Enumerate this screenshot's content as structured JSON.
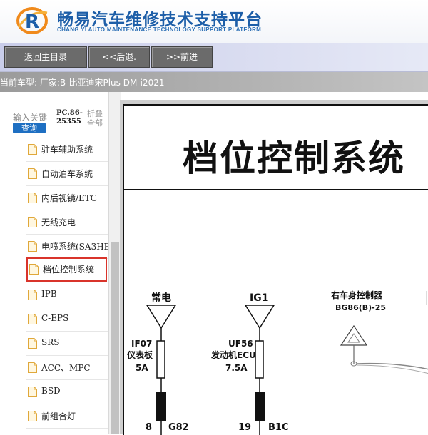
{
  "header": {
    "title": "畅易汽车维修技术支持平台",
    "subtitle": "CHANG YI AUTO MAINTENANCE TECHNOLOGY SUPPORT PLATFORM",
    "logo_icon": "cy-logo-icon",
    "brand_color": "#1d5ea8"
  },
  "toolbar": {
    "home_label": "返回主目录",
    "back_label": "<<后退.",
    "forward_label": ">>前进"
  },
  "current_car": {
    "text": "当前车型:  厂家:B-比亚迪宋Plus DM-i2021"
  },
  "left_panel": {
    "search_placeholder": "输入关键字",
    "query_label": "查询",
    "pc_label": "PC.86-25355",
    "fold_label": "折叠全部",
    "tree_items": [
      {
        "label": "驻车辅助系统",
        "icon": "file-icon"
      },
      {
        "label": "自动泊车系统",
        "icon": "file-icon"
      },
      {
        "label": "内后视镜/ETC",
        "icon": "file-icon"
      },
      {
        "label": "无线充电",
        "icon": "file-icon"
      },
      {
        "label": "电喷系统(SA3HE",
        "icon": "file-icon"
      },
      {
        "label": "档位控制系统",
        "icon": "file-icon",
        "selected": true
      },
      {
        "label": "IPB",
        "icon": "file-icon"
      },
      {
        "label": "C-EPS",
        "icon": "file-icon"
      },
      {
        "label": "SRS",
        "icon": "file-icon"
      },
      {
        "label": "ACC、MPC",
        "icon": "file-icon"
      },
      {
        "label": "BSD",
        "icon": "file-icon"
      },
      {
        "label": "前组合灯",
        "icon": "file-icon"
      }
    ],
    "selected_color": "#d9342b"
  },
  "diagram": {
    "title": "档位控制系统",
    "col1": {
      "power": "常电",
      "fuse": "IF07",
      "fuse_loc": "仪表板",
      "fuse_rating": "5A",
      "pin": "8",
      "connector": "G82"
    },
    "col2": {
      "power": "IG1",
      "fuse": "UF56",
      "fuse_loc": "发动机ECU",
      "fuse_rating": "7.5A",
      "pin": "19",
      "connector": "B1C"
    },
    "col3": {
      "module": "右车身控制器",
      "connector": "BG86(B)-25"
    }
  }
}
